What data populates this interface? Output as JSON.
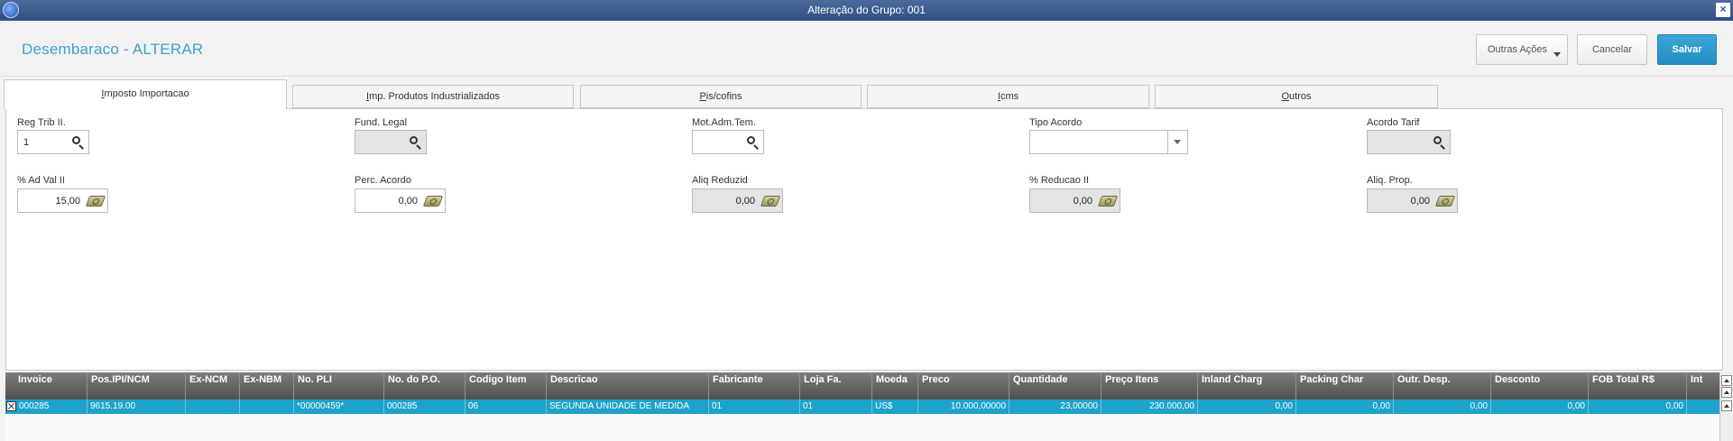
{
  "window": {
    "title": "Alteração do Grupo: 001"
  },
  "header": {
    "title": "Desembaraco - ALTERAR",
    "buttons": {
      "more": "Outras Ações",
      "cancel": "Cancelar",
      "save": "Salvar"
    }
  },
  "tabs": [
    {
      "label": "Imposto Importacao",
      "accel": "I",
      "rest": "mposto Importacao",
      "active": true
    },
    {
      "label": "Imp. Produtos Industrializados",
      "accel": "I",
      "rest": "mp. Produtos Industrializados",
      "active": false
    },
    {
      "label": "Pis/cofins",
      "accel": "P",
      "rest": "is/cofins",
      "active": false
    },
    {
      "label": "Icms",
      "accel": "I",
      "rest": "cms",
      "active": false
    },
    {
      "label": "Outros",
      "accel": "O",
      "rest": "utros",
      "active": false
    }
  ],
  "form": {
    "reg_trib_ii": {
      "label": "Reg Trib II.",
      "value": "1"
    },
    "fund_legal": {
      "label": "Fund. Legal",
      "value": ""
    },
    "mot_adm_tem": {
      "label": "Mot.Adm.Tem.",
      "value": ""
    },
    "tipo_acordo": {
      "label": "Tipo Acordo",
      "value": ""
    },
    "acordo_tarif": {
      "label": "Acordo Tarif",
      "value": ""
    },
    "ad_val_ii": {
      "label": "% Ad Val II",
      "value": "15,00"
    },
    "perc_acordo": {
      "label": "Perc. Acordo",
      "value": "0,00"
    },
    "aliq_reduzid": {
      "label": "Aliq Reduzid",
      "value": "0,00"
    },
    "reducao_ii": {
      "label": "% Reducao II",
      "value": "0,00"
    },
    "aliq_prop": {
      "label": "Aliq. Prop.",
      "value": "0,00"
    }
  },
  "grid": {
    "columns": [
      "Invoice",
      "Pos.IPI/NCM",
      "Ex-NCM",
      "Ex-NBM",
      "No. PLI",
      "No. do P.O.",
      "Codigo Item",
      "Descricao",
      "Fabricante",
      "Loja Fa.",
      "Moeda",
      "Preco",
      "Quantidade",
      "Preço Itens",
      "Inland Charg",
      "Packing Char",
      "Outr. Desp.",
      "Desconto",
      "FOB Total R$",
      "Int"
    ],
    "rows": [
      [
        "000285",
        "9615.19.00",
        "",
        "",
        "*00000459*",
        "000285",
        "06",
        "SEGUNDA UNIDADE DE MEDIDA",
        "01",
        "01",
        "US$",
        "10.000,00000",
        "23,00000",
        "230.000,00",
        "0,00",
        "0,00",
        "0,00",
        "0,00",
        "0,00",
        ""
      ]
    ]
  },
  "icons": [
    "app-icon",
    "close-icon",
    "search-icon",
    "money-icon",
    "dropdown-icon",
    "scroll-up-icon"
  ],
  "colors": {
    "accent": "#3ea0d6",
    "save_button": "#2a98ca",
    "selected_row": "#1da3c9",
    "title_bar": "#3a5a8f"
  }
}
